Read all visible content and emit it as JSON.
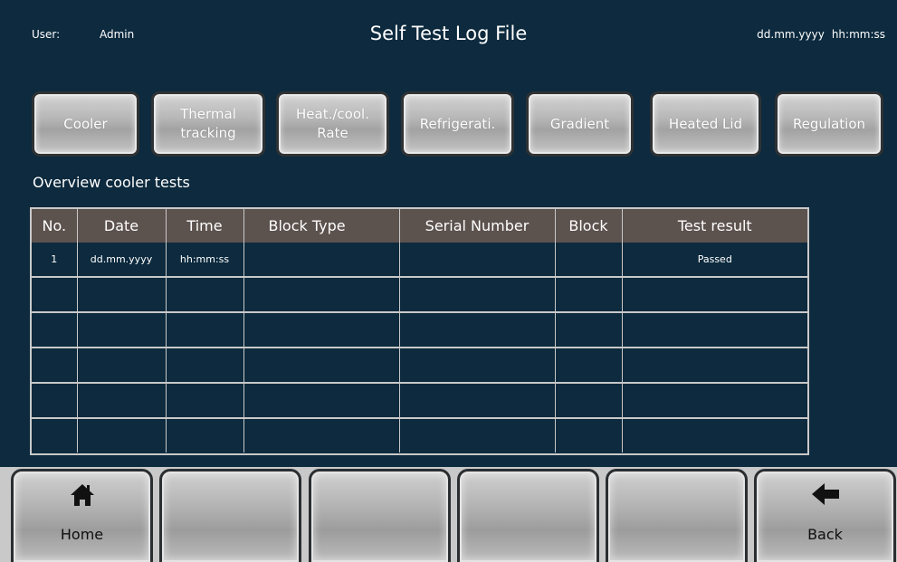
{
  "header": {
    "user_label": "User:",
    "user_value": "Admin",
    "title": "Self Test Log File",
    "date": "dd.mm.yyyy",
    "time": "hh:mm:ss"
  },
  "tabs": [
    {
      "label": "Cooler"
    },
    {
      "label": "Thermal tracking"
    },
    {
      "label": "Heat./cool. Rate"
    },
    {
      "label": "Refrigerati."
    },
    {
      "label": "Gradient"
    },
    {
      "label": "Heated Lid"
    },
    {
      "label": "Regulation"
    }
  ],
  "section_title": "Overview cooler tests",
  "table": {
    "columns": [
      "No.",
      "Date",
      "Time",
      "Block Type",
      "Serial Number",
      "Block",
      "Test result"
    ],
    "rows": [
      [
        "1",
        "dd.mm.yyyy",
        "hh:mm:ss",
        "",
        "",
        "",
        "Passed"
      ],
      [
        "",
        "",
        "",
        "",
        "",
        "",
        ""
      ],
      [
        "",
        "",
        "",
        "",
        "",
        "",
        ""
      ],
      [
        "",
        "",
        "",
        "",
        "",
        "",
        ""
      ],
      [
        "",
        "",
        "",
        "",
        "",
        "",
        ""
      ],
      [
        "",
        "",
        "",
        "",
        "",
        "",
        ""
      ]
    ]
  },
  "bottom_buttons": [
    {
      "label": "Home",
      "icon": "home-icon"
    },
    {
      "label": "",
      "icon": ""
    },
    {
      "label": "",
      "icon": ""
    },
    {
      "label": "",
      "icon": ""
    },
    {
      "label": "",
      "icon": ""
    },
    {
      "label": "Back",
      "icon": "arrow-left-icon"
    }
  ]
}
